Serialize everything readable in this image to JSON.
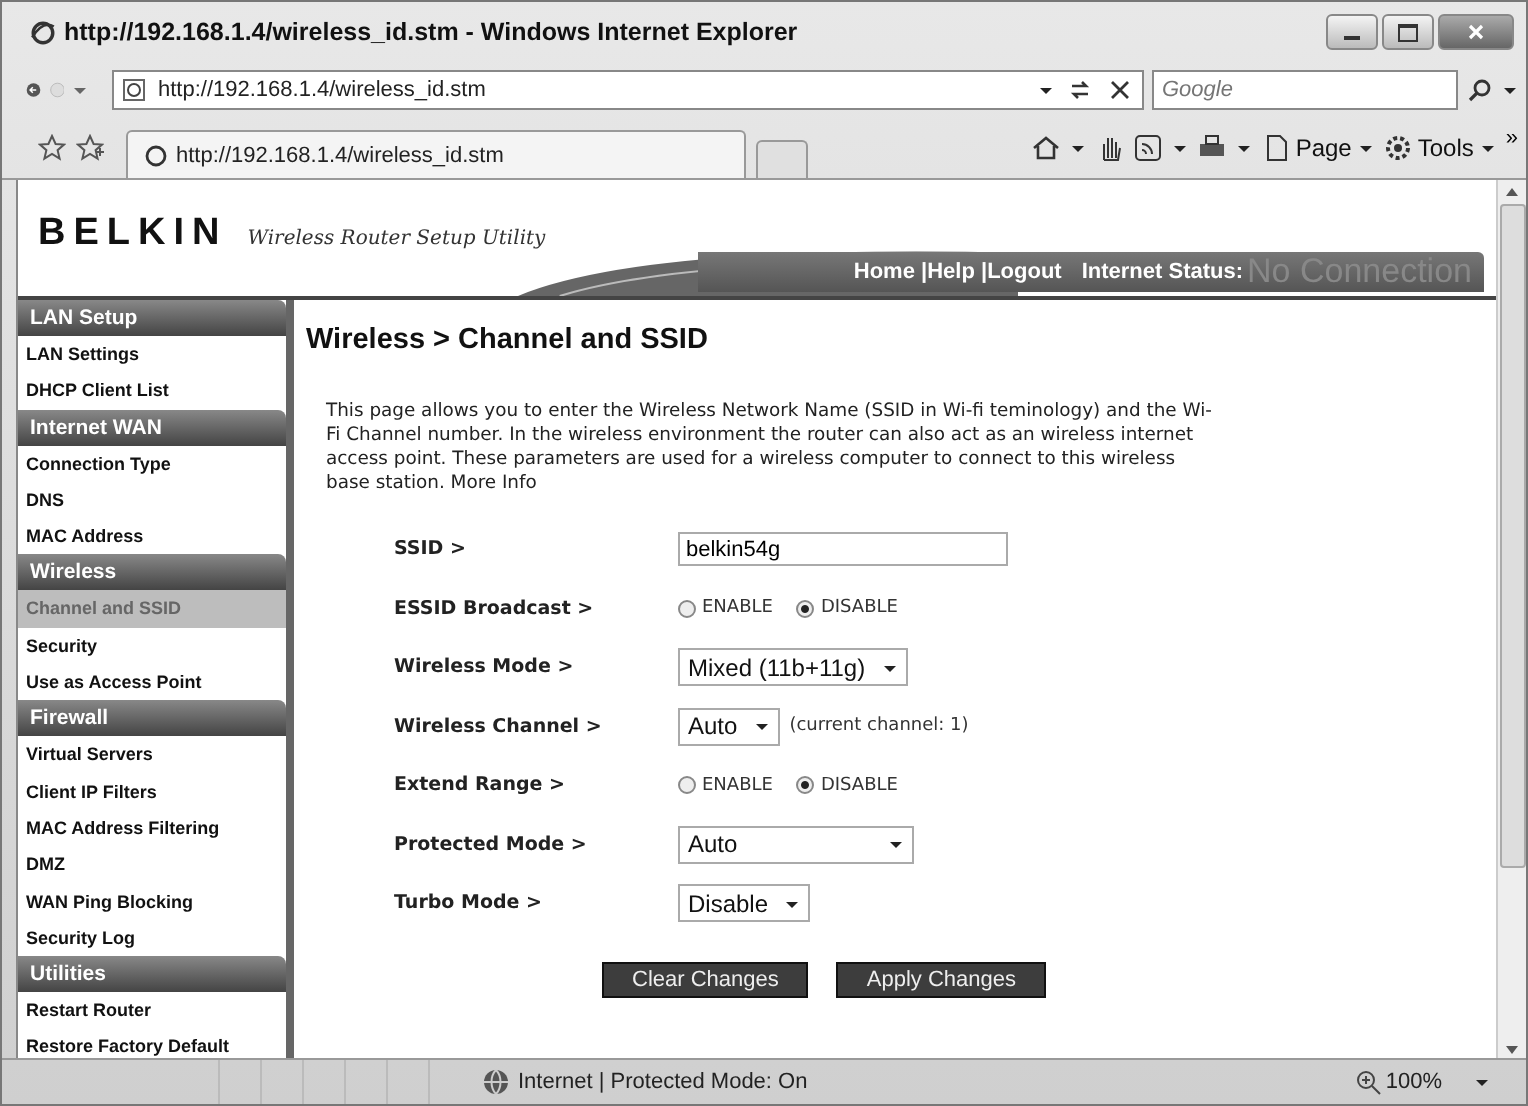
{
  "window": {
    "title": "http://192.168.1.4/wireless_id.stm - Windows Internet Explorer"
  },
  "address_bar": {
    "url": "http://192.168.1.4/wireless_id.stm"
  },
  "search": {
    "placeholder": "Google"
  },
  "tabs": [
    {
      "label": "http://192.168.1.4/wireless_id.stm",
      "selected": true
    }
  ],
  "command_bar": {
    "items": [
      {
        "label": "Page",
        "kind": "page"
      },
      {
        "label": "Tools",
        "kind": "tools"
      }
    ],
    "overflow": "»"
  },
  "header": {
    "brand": "BELKIN",
    "tagline": "Wireless Router Setup Utility",
    "links": [
      {
        "label": "Home "
      },
      {
        "label": "|Help "
      },
      {
        "label": "|Logout"
      }
    ],
    "status_label": "Internet Status:",
    "status_value": "No Connection"
  },
  "sidebar": {
    "sections": [
      {
        "heading": "LAN Setup",
        "items": [
          {
            "label": "LAN Settings",
            "selected": false
          },
          {
            "label": "DHCP Client List",
            "selected": false
          }
        ]
      },
      {
        "heading": "Internet WAN",
        "items": [
          {
            "label": "Connection Type",
            "selected": false
          },
          {
            "label": "DNS",
            "selected": false
          },
          {
            "label": "MAC Address",
            "selected": false
          }
        ]
      },
      {
        "heading": "Wireless",
        "items": [
          {
            "label": "Channel and SSID",
            "selected": true
          },
          {
            "label": "Security",
            "selected": false
          },
          {
            "label": "Use as Access Point",
            "selected": false
          }
        ]
      },
      {
        "heading": "Firewall",
        "items": [
          {
            "label": "Virtual Servers",
            "selected": false
          },
          {
            "label": "Client IP Filters",
            "selected": false
          },
          {
            "label": "MAC Address Filtering",
            "selected": false
          },
          {
            "label": "DMZ",
            "selected": false
          },
          {
            "label": "WAN Ping Blocking",
            "selected": false
          },
          {
            "label": "Security Log",
            "selected": false
          }
        ]
      },
      {
        "heading": "Utilities",
        "items": [
          {
            "label": "Restart Router",
            "selected": false
          },
          {
            "label": "Restore Factory Default",
            "selected": false
          }
        ]
      }
    ]
  },
  "content": {
    "title": "Wireless > Channel and SSID",
    "description": "This page allows you to enter the Wireless Network Name (SSID in Wi-fi teminology) and the Wi-Fi Channel number. In the wireless environment the router can also act as an wireless internet access point. These parameters are used for a wireless computer to connect to this wireless base station.",
    "more_info": "More Info",
    "fields": [
      {
        "label": "SSID >",
        "kind": "text",
        "value": "belkin54g"
      },
      {
        "label": "ESSID Broadcast >",
        "kind": "radio",
        "options": [
          {
            "label": "ENABLE",
            "selected": false
          },
          {
            "label": "DISABLE",
            "selected": true
          }
        ]
      },
      {
        "label": "Wireless Mode >",
        "kind": "select",
        "value": "Mixed (11b+11g)"
      },
      {
        "label": "Wireless Channel >",
        "kind": "select",
        "value": "Auto",
        "note": "(current channel: 1)"
      },
      {
        "label": "Extend Range >",
        "kind": "radio",
        "options": [
          {
            "label": "ENABLE",
            "selected": false
          },
          {
            "label": "DISABLE",
            "selected": true
          }
        ]
      },
      {
        "label": "Protected Mode >",
        "kind": "select",
        "value": "Auto"
      },
      {
        "label": "Turbo Mode >",
        "kind": "select",
        "value": "Disable"
      }
    ],
    "buttons": [
      "Clear Changes",
      "Apply Changes"
    ]
  },
  "status_bar": {
    "zone": "Internet | Protected Mode: On",
    "zoom": "100%"
  }
}
